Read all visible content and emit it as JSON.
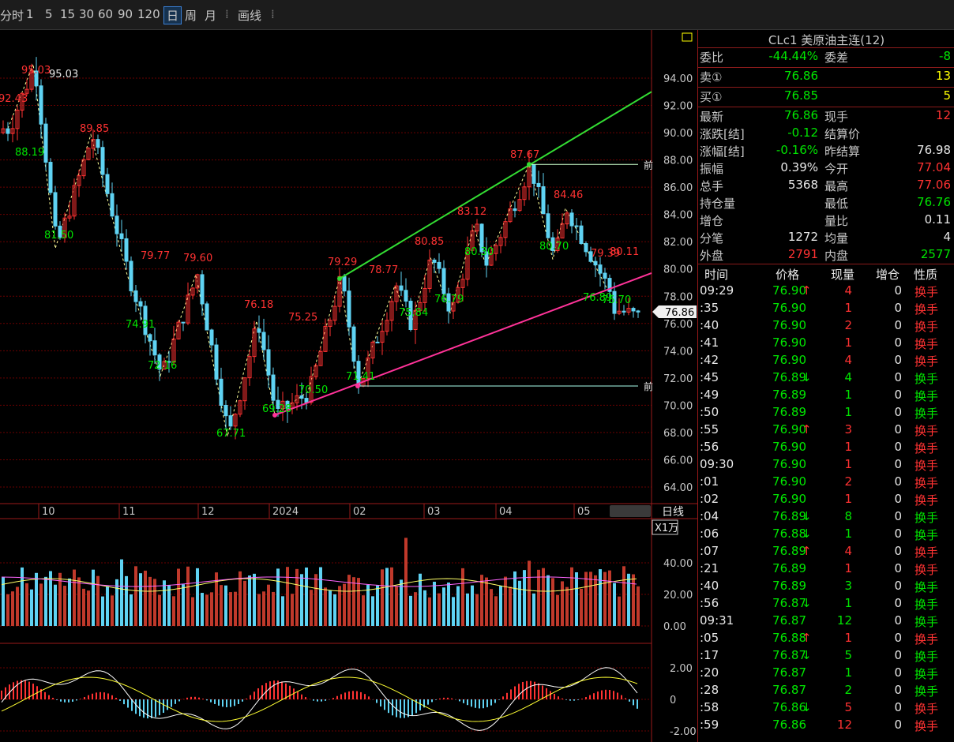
{
  "toolbar": {
    "periods": [
      "分时",
      "1",
      "5",
      "15",
      "30",
      "60",
      "90",
      "120",
      "日",
      "周",
      "月"
    ],
    "active": "日",
    "draw_label": "画线"
  },
  "chart": {
    "price_ticks": [
      "94.00",
      "92.00",
      "90.00",
      "88.00",
      "86.00",
      "84.00",
      "82.00",
      "80.00",
      "78.00",
      "76.00",
      "74.00",
      "72.00",
      "70.00",
      "68.00",
      "66.00",
      "64.00"
    ],
    "date_labels": [
      "10",
      "11",
      "12",
      "2024",
      "02",
      "03",
      "04",
      "05"
    ],
    "period_label": "日线",
    "current_price": "76.86",
    "price_annotations": [
      {
        "text": "95.03",
        "color": "#e8e8e8"
      },
      {
        "text": "95.03",
        "color": "#ff3232"
      },
      {
        "text": "92.43",
        "color": "#ff3232"
      },
      {
        "text": "88.19",
        "color": "#00e600"
      },
      {
        "text": "89.85",
        "color": "#ff3232"
      },
      {
        "text": "81.50",
        "color": "#00e600"
      },
      {
        "text": "79.77",
        "color": "#ff3232"
      },
      {
        "text": "79.60",
        "color": "#ff3232"
      },
      {
        "text": "74.91",
        "color": "#00e600"
      },
      {
        "text": "72.16",
        "color": "#00e600"
      },
      {
        "text": "76.18",
        "color": "#ff3232"
      },
      {
        "text": "67.71",
        "color": "#00e600"
      },
      {
        "text": "75.25",
        "color": "#ff3232"
      },
      {
        "text": "69.28",
        "color": "#00e600"
      },
      {
        "text": "70.50",
        "color": "#00e600"
      },
      {
        "text": "79.29",
        "color": "#ff3232"
      },
      {
        "text": "71.41",
        "color": "#00e600"
      },
      {
        "text": "78.77",
        "color": "#ff3232"
      },
      {
        "text": "75.84",
        "color": "#00e600"
      },
      {
        "text": "80.85",
        "color": "#ff3232"
      },
      {
        "text": "76.79",
        "color": "#00e600"
      },
      {
        "text": "83.12",
        "color": "#ff3232"
      },
      {
        "text": "80.30",
        "color": "#00e600"
      },
      {
        "text": "87.67",
        "color": "#ff3232"
      },
      {
        "text": "80.70",
        "color": "#00e600"
      },
      {
        "text": "84.46",
        "color": "#ff3232"
      },
      {
        "text": "79.39",
        "color": "#ff3232"
      },
      {
        "text": "80.11",
        "color": "#ff3232"
      },
      {
        "text": "76.89",
        "color": "#00e600"
      },
      {
        "text": "76.70",
        "color": "#00e600"
      }
    ],
    "line_end_label": "前",
    "volume_unit": "X1万",
    "volume_ticks": [
      "40.00",
      "20.00",
      "0.00"
    ],
    "macd_ticks": [
      "2.00",
      "0",
      "-2.00"
    ]
  },
  "quote": {
    "title": "CLc1 美原油主连(12)",
    "rows": [
      [
        {
          "t": "委比",
          "c": "gray"
        },
        {
          "t": "-44.44%",
          "c": "green"
        },
        {
          "t": "委差",
          "c": "gray"
        },
        {
          "t": "-8",
          "c": "green"
        }
      ],
      [
        {
          "t": "卖①",
          "c": "gray"
        },
        {
          "t": "76.86",
          "c": "green"
        },
        {
          "t": "",
          "c": "gray"
        },
        {
          "t": "13",
          "c": "yellow"
        }
      ],
      [
        {
          "t": "买①",
          "c": "gray"
        },
        {
          "t": "76.85",
          "c": "green"
        },
        {
          "t": "",
          "c": "gray"
        },
        {
          "t": "5",
          "c": "yellow"
        }
      ],
      [
        {
          "t": "最新",
          "c": "gray"
        },
        {
          "t": "76.86",
          "c": "green"
        },
        {
          "t": "现手",
          "c": "gray"
        },
        {
          "t": "12",
          "c": "red"
        }
      ],
      [
        {
          "t": "涨跌[结]",
          "c": "gray"
        },
        {
          "t": "-0.12",
          "c": "green"
        },
        {
          "t": "结算价",
          "c": "gray"
        },
        {
          "t": "",
          "c": "gray"
        }
      ],
      [
        {
          "t": "涨幅[结]",
          "c": "gray"
        },
        {
          "t": "-0.16%",
          "c": "green"
        },
        {
          "t": "昨结算",
          "c": "gray"
        },
        {
          "t": "76.98",
          "c": "white"
        }
      ],
      [
        {
          "t": "振幅",
          "c": "gray"
        },
        {
          "t": "0.39%",
          "c": "white"
        },
        {
          "t": "今开",
          "c": "gray"
        },
        {
          "t": "77.04",
          "c": "red"
        }
      ],
      [
        {
          "t": "总手",
          "c": "gray"
        },
        {
          "t": "5368",
          "c": "white"
        },
        {
          "t": "最高",
          "c": "gray"
        },
        {
          "t": "77.06",
          "c": "red"
        }
      ],
      [
        {
          "t": "持仓量",
          "c": "gray"
        },
        {
          "t": "",
          "c": "white"
        },
        {
          "t": "最低",
          "c": "gray"
        },
        {
          "t": "76.76",
          "c": "green"
        }
      ],
      [
        {
          "t": "增仓",
          "c": "gray"
        },
        {
          "t": "",
          "c": "white"
        },
        {
          "t": "量比",
          "c": "gray"
        },
        {
          "t": "0.11",
          "c": "white"
        }
      ],
      [
        {
          "t": "分笔",
          "c": "gray"
        },
        {
          "t": "1272",
          "c": "white"
        },
        {
          "t": "均量",
          "c": "gray"
        },
        {
          "t": "4",
          "c": "white"
        }
      ],
      [
        {
          "t": "外盘",
          "c": "gray"
        },
        {
          "t": "2791",
          "c": "red"
        },
        {
          "t": "内盘",
          "c": "gray"
        },
        {
          "t": "2577",
          "c": "green"
        }
      ]
    ],
    "trade_headers": [
      "时间",
      "价格",
      "现量",
      "增仓",
      "性质"
    ],
    "trades": [
      {
        "time": "09:29",
        "price": "76.90",
        "arrow": "↑",
        "arrow_c": "red",
        "vol": "4",
        "vol_c": "red",
        "oi": "0",
        "kind": "换手",
        "kind_c": "red"
      },
      {
        "time": ":35",
        "price": "76.90",
        "arrow": "",
        "arrow_c": "red",
        "vol": "1",
        "vol_c": "red",
        "oi": "0",
        "kind": "换手",
        "kind_c": "red"
      },
      {
        "time": ":40",
        "price": "76.90",
        "arrow": "",
        "arrow_c": "red",
        "vol": "2",
        "vol_c": "red",
        "oi": "0",
        "kind": "换手",
        "kind_c": "red"
      },
      {
        "time": ":41",
        "price": "76.90",
        "arrow": "",
        "arrow_c": "red",
        "vol": "1",
        "vol_c": "red",
        "oi": "0",
        "kind": "换手",
        "kind_c": "red"
      },
      {
        "time": ":42",
        "price": "76.90",
        "arrow": "",
        "arrow_c": "red",
        "vol": "4",
        "vol_c": "red",
        "oi": "0",
        "kind": "换手",
        "kind_c": "red"
      },
      {
        "time": ":45",
        "price": "76.89",
        "arrow": "↓",
        "arrow_c": "green",
        "vol": "4",
        "vol_c": "green",
        "oi": "0",
        "kind": "换手",
        "kind_c": "green"
      },
      {
        "time": ":49",
        "price": "76.89",
        "arrow": "",
        "arrow_c": "green",
        "vol": "1",
        "vol_c": "green",
        "oi": "0",
        "kind": "换手",
        "kind_c": "green"
      },
      {
        "time": ":50",
        "price": "76.89",
        "arrow": "",
        "arrow_c": "green",
        "vol": "1",
        "vol_c": "green",
        "oi": "0",
        "kind": "换手",
        "kind_c": "green"
      },
      {
        "time": ":55",
        "price": "76.90",
        "arrow": "↑",
        "arrow_c": "red",
        "vol": "3",
        "vol_c": "red",
        "oi": "0",
        "kind": "换手",
        "kind_c": "red"
      },
      {
        "time": ":56",
        "price": "76.90",
        "arrow": "",
        "arrow_c": "red",
        "vol": "1",
        "vol_c": "red",
        "oi": "0",
        "kind": "换手",
        "kind_c": "red"
      },
      {
        "time": "09:30",
        "price": "76.90",
        "arrow": "",
        "arrow_c": "red",
        "vol": "1",
        "vol_c": "red",
        "oi": "0",
        "kind": "换手",
        "kind_c": "red"
      },
      {
        "time": ":01",
        "price": "76.90",
        "arrow": "",
        "arrow_c": "red",
        "vol": "2",
        "vol_c": "red",
        "oi": "0",
        "kind": "换手",
        "kind_c": "red"
      },
      {
        "time": ":02",
        "price": "76.90",
        "arrow": "",
        "arrow_c": "red",
        "vol": "1",
        "vol_c": "red",
        "oi": "0",
        "kind": "换手",
        "kind_c": "red"
      },
      {
        "time": ":04",
        "price": "76.89",
        "arrow": "↓",
        "arrow_c": "green",
        "vol": "8",
        "vol_c": "green",
        "oi": "0",
        "kind": "换手",
        "kind_c": "green"
      },
      {
        "time": ":06",
        "price": "76.88",
        "arrow": "↓",
        "arrow_c": "green",
        "vol": "1",
        "vol_c": "green",
        "oi": "0",
        "kind": "换手",
        "kind_c": "green"
      },
      {
        "time": ":07",
        "price": "76.89",
        "arrow": "↑",
        "arrow_c": "red",
        "vol": "4",
        "vol_c": "red",
        "oi": "0",
        "kind": "换手",
        "kind_c": "red"
      },
      {
        "time": ":21",
        "price": "76.89",
        "arrow": "",
        "arrow_c": "red",
        "vol": "1",
        "vol_c": "red",
        "oi": "0",
        "kind": "换手",
        "kind_c": "red"
      },
      {
        "time": ":40",
        "price": "76.89",
        "arrow": "",
        "arrow_c": "green",
        "vol": "3",
        "vol_c": "green",
        "oi": "0",
        "kind": "换手",
        "kind_c": "green"
      },
      {
        "time": ":56",
        "price": "76.87",
        "arrow": "↓",
        "arrow_c": "green",
        "vol": "1",
        "vol_c": "green",
        "oi": "0",
        "kind": "换手",
        "kind_c": "green"
      },
      {
        "time": "09:31",
        "price": "76.87",
        "arrow": "",
        "arrow_c": "green",
        "vol": "12",
        "vol_c": "green",
        "oi": "0",
        "kind": "换手",
        "kind_c": "green"
      },
      {
        "time": ":05",
        "price": "76.88",
        "arrow": "↑",
        "arrow_c": "red",
        "vol": "1",
        "vol_c": "red",
        "oi": "0",
        "kind": "换手",
        "kind_c": "red"
      },
      {
        "time": ":17",
        "price": "76.87",
        "arrow": "↓",
        "arrow_c": "green",
        "vol": "5",
        "vol_c": "green",
        "oi": "0",
        "kind": "换手",
        "kind_c": "green"
      },
      {
        "time": ":20",
        "price": "76.87",
        "arrow": "",
        "arrow_c": "green",
        "vol": "1",
        "vol_c": "green",
        "oi": "0",
        "kind": "换手",
        "kind_c": "green"
      },
      {
        "time": ":28",
        "price": "76.87",
        "arrow": "",
        "arrow_c": "green",
        "vol": "2",
        "vol_c": "green",
        "oi": "0",
        "kind": "换手",
        "kind_c": "green"
      },
      {
        "time": ":58",
        "price": "76.86",
        "arrow": "↓",
        "arrow_c": "green",
        "vol": "5",
        "vol_c": "red",
        "oi": "0",
        "kind": "换手",
        "kind_c": "red"
      },
      {
        "time": ":59",
        "price": "76.86",
        "arrow": "",
        "arrow_c": "green",
        "vol": "12",
        "vol_c": "red",
        "oi": "0",
        "kind": "换手",
        "kind_c": "red"
      }
    ]
  },
  "colors": {
    "up": "#ff3232",
    "down": "#00e600",
    "bear_candle": "#5fd3f3",
    "grid": "#6a0000",
    "axis": "#9a1a1a",
    "upper_trend": "#33dd33",
    "lower_trend": "#ff3399"
  }
}
